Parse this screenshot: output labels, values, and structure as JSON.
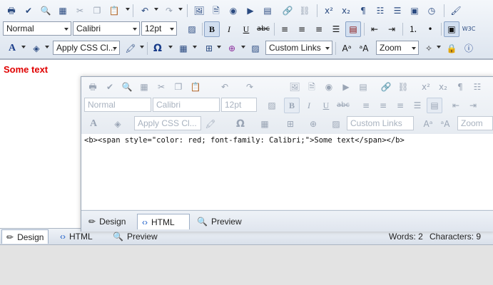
{
  "toolbar": {
    "row1_icons": [
      "print-icon",
      "spellcheck-icon",
      "find-icon",
      "select-all-icon",
      "cut-icon",
      "copy-icon",
      "paste-icon",
      "undo-icon",
      "redo-icon",
      "insert-image-icon",
      "insert-media-icon",
      "insert-flash-icon",
      "insert-video-icon",
      "insert-document-icon",
      "hyperlink-icon",
      "remove-link-icon",
      "superscript-icon",
      "subscript-icon",
      "paragraph-icon",
      "insert-table-icon",
      "horizontal-rule-icon",
      "template-icon",
      "insert-date-icon",
      "format-painter-icon"
    ],
    "row2": {
      "format": "Normal",
      "font": "Calibri",
      "size": "12pt",
      "bold": "B",
      "italic": "I",
      "underline": "U",
      "strike": "abc",
      "w3c": "W3C"
    },
    "row3": {
      "css_class": "Apply CSS Cl...",
      "custom_links": "Custom Links",
      "zoom": "Zoom"
    }
  },
  "content": {
    "text": "Some text",
    "text_color": "#e00000"
  },
  "tabs": {
    "design": "Design",
    "html": "HTML",
    "preview": "Preview"
  },
  "status": {
    "words": "Words: 2",
    "characters": "Characters: 9"
  },
  "overlay": {
    "code": "<b><span style=\"color: red; font-family: Calibri;\">Some text</span></b>",
    "format": "Normal",
    "font": "Calibri",
    "size": "12pt",
    "css_class": "Apply CSS Cl...",
    "custom_links": "Custom Links",
    "zoom": "Zoom",
    "tabs": {
      "design": "Design",
      "html": "HTML",
      "preview": "Preview"
    }
  }
}
